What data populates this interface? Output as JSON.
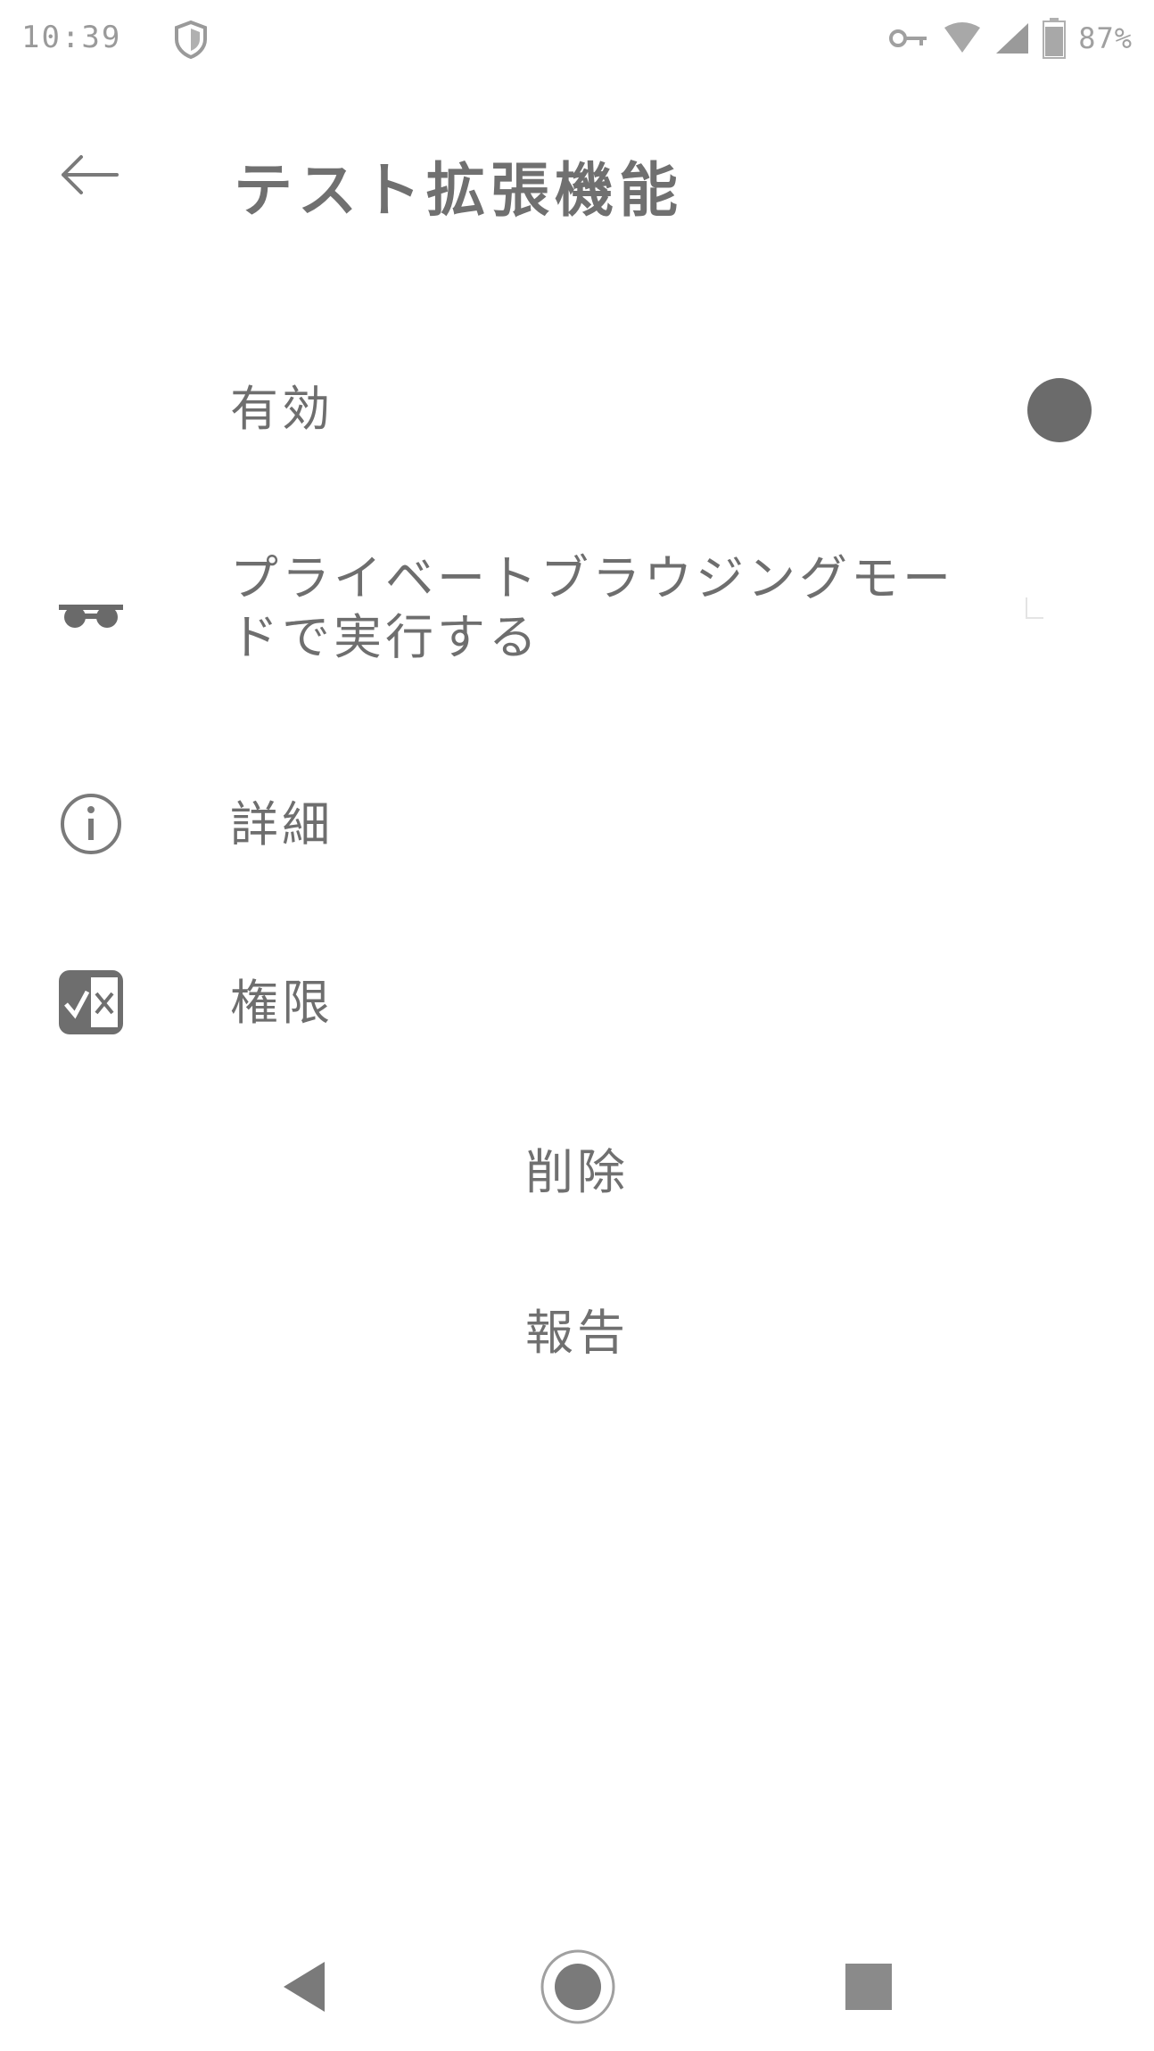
{
  "status_bar": {
    "time": "10:39",
    "notification_icon": "shield-icon",
    "icons": [
      "key-icon",
      "wifi-icon",
      "signal-icon",
      "battery-icon"
    ],
    "battery_percent": "87%"
  },
  "app_bar": {
    "back_icon": "arrow-left-icon",
    "title": "テスト拡張機能"
  },
  "settings": {
    "enabled": {
      "label": "有効",
      "toggle_state": "on"
    },
    "private_browsing": {
      "icon": "incognito-mask-icon",
      "label": "プライベートブラウジングモードで実行する",
      "checked": false
    },
    "details": {
      "icon": "info-icon",
      "label": "詳細"
    },
    "permissions": {
      "icon": "permissions-icon",
      "label": "権限"
    }
  },
  "actions": {
    "remove_label": "削除",
    "report_label": "報告"
  },
  "nav_bar": {
    "icons": [
      "nav-back-icon",
      "nav-home-icon",
      "nav-recents-icon"
    ]
  },
  "colors": {
    "background": "#ffffff",
    "text": "#6e6e6e",
    "toggle_on": "#6b6b6b"
  }
}
